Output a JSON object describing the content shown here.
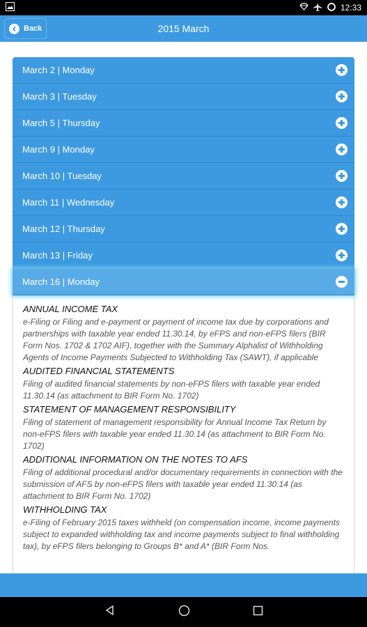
{
  "status_bar": {
    "time": "12:33",
    "icons": [
      "image-icon",
      "diamond-icon",
      "airplane-icon",
      "sync-icon"
    ]
  },
  "header": {
    "back_label": "Back",
    "title": "2015 March"
  },
  "accordion": {
    "items": [
      {
        "label": "March 2 | Monday",
        "state": "collapsed"
      },
      {
        "label": "March 3 | Tuesday",
        "state": "collapsed"
      },
      {
        "label": "March 5 | Thursday",
        "state": "collapsed"
      },
      {
        "label": "March 9 | Monday",
        "state": "collapsed"
      },
      {
        "label": "March 10 | Tuesday",
        "state": "collapsed"
      },
      {
        "label": "March 11 | Wednesday",
        "state": "collapsed"
      },
      {
        "label": "March 12 | Thursday",
        "state": "collapsed"
      },
      {
        "label": "March 13 | Friday",
        "state": "collapsed"
      },
      {
        "label": "March 16 | Monday",
        "state": "expanded"
      }
    ],
    "expanded_sections": [
      {
        "title": "ANNUAL INCOME TAX",
        "body": "e-Filing or Filing and e-payment or payment of income tax due by corporations and partnerships with taxable year ended 11.30.14, by eFPS and non-eFPS filers (BIR Form Nos. 1702 & 1702 AIF), together with the Summary Alphalist of Withholding Agents of Income Payments Subjected to Withholding Tax (SAWT), if applicable"
      },
      {
        "title": "AUDITED FINANCIAL STATEMENTS",
        "body": "Filing of audited financial statements by non-eFPS filers with taxable year ended 11.30.14 (as attachment to BIR Form No. 1702)"
      },
      {
        "title": "STATEMENT OF MANAGEMENT RESPONSIBILITY",
        "body": "Filing of statement of management responsibility for Annual Income Tax Return by non-eFPS filers with taxable year ended 11.30.14 (as attachment to BIR Form No. 1702)"
      },
      {
        "title": "ADDITIONAL INFORMATION ON THE NOTES TO AFS",
        "body": "Filing of additional procedural and/or documentary requirements in connection with the submission of AFS by non-eFPS filers with taxable year ended 11.30.14 (as attachment to BIR Form No. 1702)"
      },
      {
        "title": "WITHHOLDING TAX",
        "body": "e-Filing of February 2015 taxes withheld (on compensation income, income payments subject to expanded withholding tax and income payments subject to final withholding tax), by eFPS filers belonging to Groups B* and A* (BIR Form Nos."
      }
    ]
  },
  "colors": {
    "primary": "#3d9ae0",
    "active_item": "#58abe6",
    "glow": "#7cd3f3"
  }
}
